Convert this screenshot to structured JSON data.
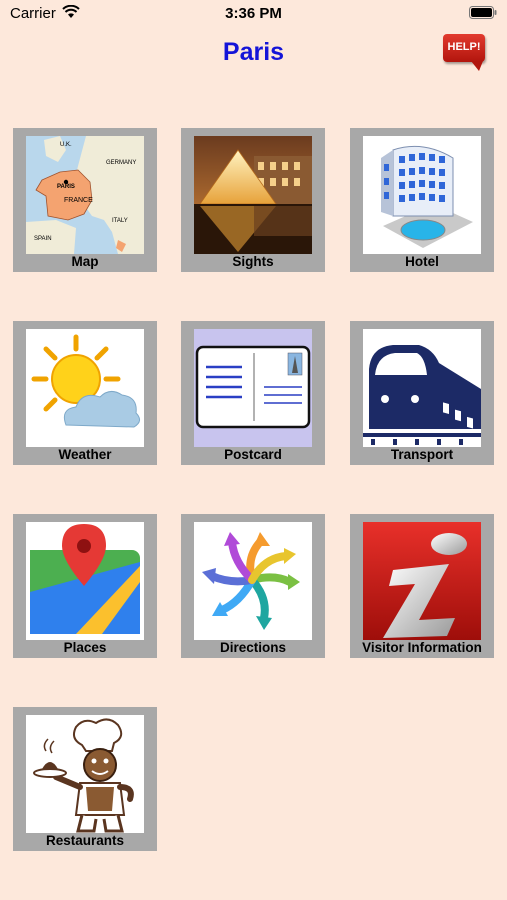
{
  "status": {
    "carrier": "Carrier",
    "time": "3:36 PM"
  },
  "header": {
    "title": "Paris",
    "help_label": "HELP!"
  },
  "map_labels": {
    "uk": "U.K.",
    "germany": "GERMANY",
    "paris": "PARIS",
    "france": "FRANCE",
    "italy": "ITALY",
    "spain": "SPAIN"
  },
  "tiles": [
    {
      "label": "Map",
      "icon": "map-icon"
    },
    {
      "label": "Sights",
      "icon": "louvre-pyramid-icon"
    },
    {
      "label": "Hotel",
      "icon": "hotel-icon"
    },
    {
      "label": "Weather",
      "icon": "sun-cloud-icon"
    },
    {
      "label": "Postcard",
      "icon": "postcard-icon"
    },
    {
      "label": "Transport",
      "icon": "train-icon"
    },
    {
      "label": "Places",
      "icon": "places-pin-icon"
    },
    {
      "label": "Directions",
      "icon": "arrows-icon"
    },
    {
      "label": "Visitor Information",
      "icon": "info-icon"
    },
    {
      "label": "Restaurants",
      "icon": "chef-icon"
    }
  ],
  "colors": {
    "background": "#fde8db",
    "title": "#1414d8",
    "tile_frame": "#a8a8a8",
    "help_red": "#d0281e"
  }
}
